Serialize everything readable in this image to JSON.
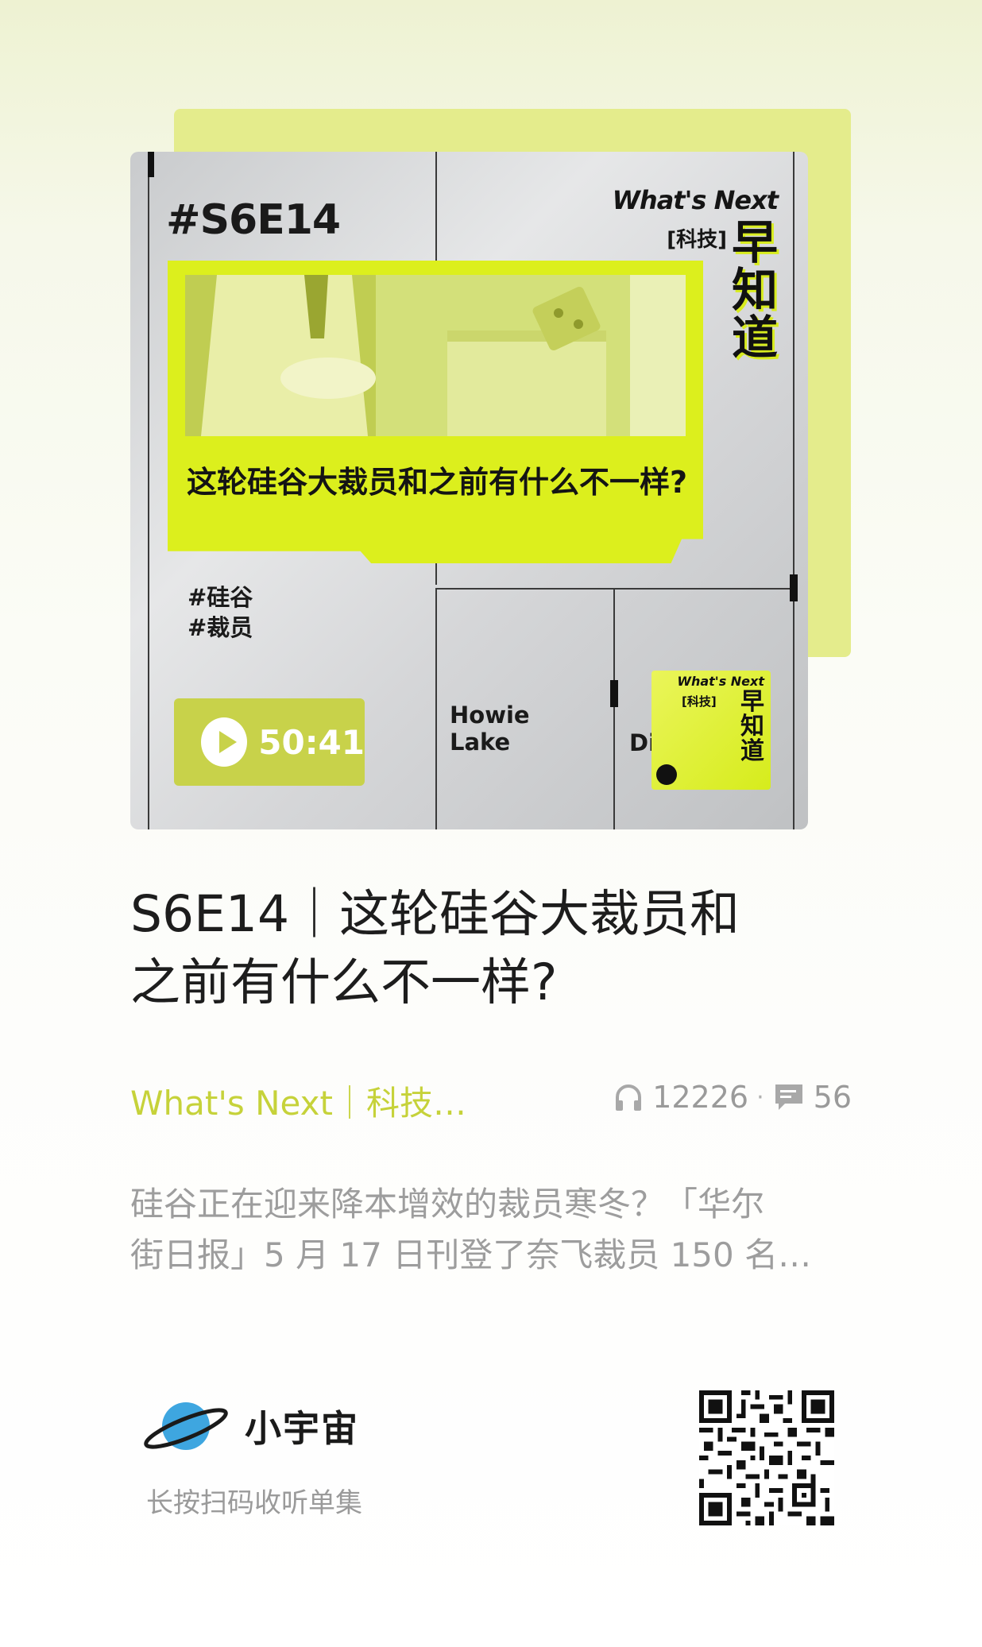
{
  "cover": {
    "episode_code": "#S6E14",
    "logo_what": "What's Next",
    "logo_tech": "[科技]",
    "logo_zao": [
      "早",
      "知",
      "道"
    ],
    "headline": "这轮硅谷大裁员和之前有什么不一样?",
    "tags": [
      "#硅谷",
      "#裁员"
    ],
    "duration": "50:41",
    "host1_line1": "Howie",
    "host1_line2": "Lake",
    "host2_partial": "Di",
    "mini_logo_what": "What's Next",
    "mini_logo_tech": "[科技]",
    "mini_logo_zao": [
      "早",
      "知",
      "道"
    ]
  },
  "episode": {
    "title_line1": "S6E14｜这轮硅谷大裁员和",
    "title_line2": "之前有什么不一样?",
    "podcast_name": "What's Next｜科技…",
    "plays": "12226",
    "separator": "·",
    "comments": "56",
    "description_line1": "硅谷正在迎来降本增效的裁员寒冬？「华尔",
    "description_line2": "街日报」5 月 17 日刊登了奈飞裁员 150 名…"
  },
  "footer": {
    "brand_name": "小宇宙",
    "scan_hint": "长按扫码收听单集"
  },
  "colors": {
    "accent": "#c6d23a",
    "cover_lime": "#dcef1d",
    "text_dark": "#1d1d1d",
    "text_gray": "#9d9d9d"
  },
  "icons": {
    "plays": "headphones-icon",
    "comments": "comment-icon",
    "play": "play-icon",
    "brand": "planet-logo-icon"
  }
}
